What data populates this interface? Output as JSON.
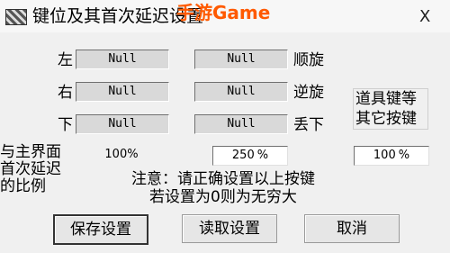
{
  "window": {
    "title": "键位及其首次延迟设置",
    "watermark": "手游Game",
    "close_glyph": "X"
  },
  "keys": [
    {
      "label": "左",
      "value": "Null"
    },
    {
      "label": "右",
      "value": "Null"
    },
    {
      "label": "下",
      "value": "Null"
    }
  ],
  "right_keys": [
    {
      "label": "顺旋",
      "value": "Null"
    },
    {
      "label": "逆旋",
      "value": "Null"
    },
    {
      "label": "丢下",
      "value": "Null"
    }
  ],
  "prop_label": "道具键等\n其它按键",
  "delay": {
    "label": "与主界面\n首次延迟\n的比例",
    "value1": "100%",
    "value2": "250",
    "value2_unit": "%",
    "value3": "100",
    "value3_unit": "%"
  },
  "notice": {
    "line1": "注意：请正确设置以上按键",
    "line2": "若设置为0则为无穷大"
  },
  "buttons": {
    "save": "保存设置",
    "read": "读取设置",
    "cancel": "取消"
  }
}
